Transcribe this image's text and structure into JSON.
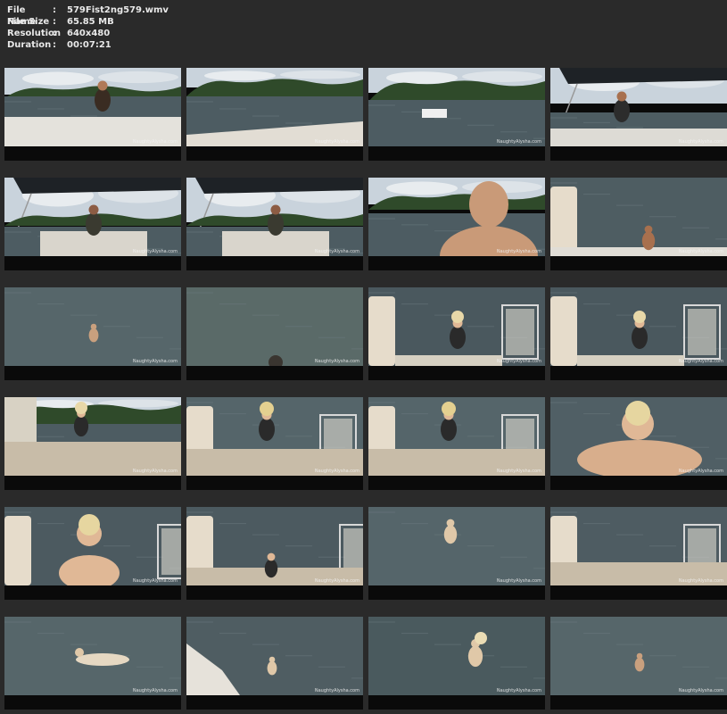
{
  "info": {
    "rows": [
      {
        "label": "File Name",
        "sep": ":",
        "value": "579Fist2ng579.wmv"
      },
      {
        "label": "File Size",
        "sep": ":",
        "value": "65.85 MB"
      },
      {
        "label": "Resolution",
        "sep": ":",
        "value": "640x480"
      },
      {
        "label": "Duration",
        "sep": ":",
        "value": "00:07:21"
      }
    ]
  },
  "watermark": "NaughtyAlysha.com",
  "colors": {
    "background": "#2a2a2a",
    "cell": "#0a0a0a",
    "text": "#e8e8e8"
  },
  "thumbnails": [
    {
      "scene": "boat-man-deck"
    },
    {
      "scene": "boat-deck-shore"
    },
    {
      "scene": "river-boats"
    },
    {
      "scene": "boat-man-canopy"
    },
    {
      "scene": "man-under-canopy"
    },
    {
      "scene": "man-under-canopy"
    },
    {
      "scene": "man-closeup"
    },
    {
      "scene": "man-ladder"
    },
    {
      "scene": "swimmer-far"
    },
    {
      "scene": "water-head"
    },
    {
      "scene": "woman-ladder"
    },
    {
      "scene": "woman-ladder"
    },
    {
      "scene": "woman-deck"
    },
    {
      "scene": "woman-deck-back"
    },
    {
      "scene": "woman-deck-back"
    },
    {
      "scene": "woman-water-close"
    },
    {
      "scene": "woman-ladder-close"
    },
    {
      "scene": "woman-ladder-low"
    },
    {
      "scene": "swimmer-near"
    },
    {
      "scene": "deck-ladder-empty"
    },
    {
      "scene": "floating"
    },
    {
      "scene": "boat-edge-swimmer"
    },
    {
      "scene": "swimmer-mid"
    },
    {
      "scene": "swimmer-far"
    }
  ]
}
